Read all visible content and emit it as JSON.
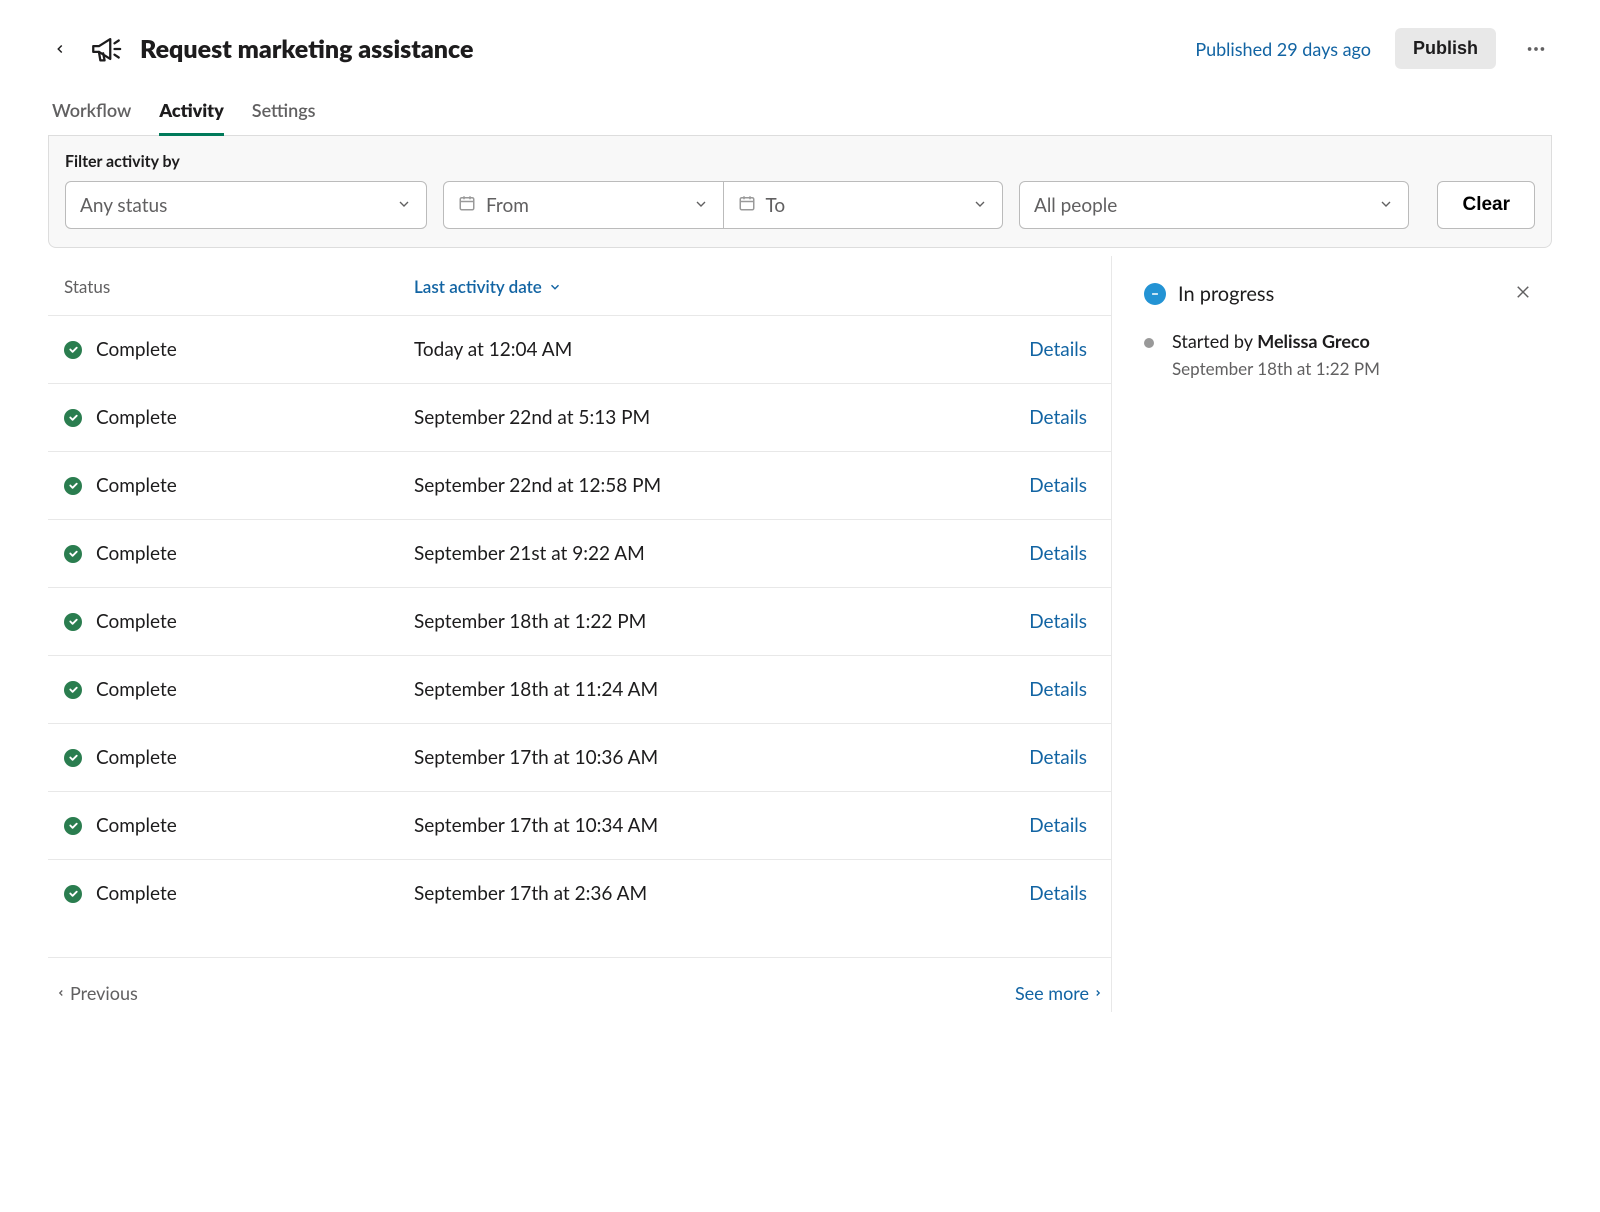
{
  "header": {
    "title": "Request marketing assistance",
    "published_status": "Published 29 days ago",
    "publish_button": "Publish"
  },
  "tabs": [
    {
      "label": "Workflow",
      "active": false
    },
    {
      "label": "Activity",
      "active": true
    },
    {
      "label": "Settings",
      "active": false
    }
  ],
  "filter": {
    "label": "Filter activity by",
    "status_placeholder": "Any status",
    "from_placeholder": "From",
    "to_placeholder": "To",
    "people_placeholder": "All people",
    "clear_button": "Clear"
  },
  "table": {
    "columns": {
      "status": "Status",
      "date": "Last activity date"
    },
    "details_label": "Details",
    "rows": [
      {
        "status": "Complete",
        "date": "Today at 12:04 AM"
      },
      {
        "status": "Complete",
        "date": "September 22nd at 5:13 PM"
      },
      {
        "status": "Complete",
        "date": "September 22nd at 12:58 PM"
      },
      {
        "status": "Complete",
        "date": "September 21st at 9:22 AM"
      },
      {
        "status": "Complete",
        "date": "September 18th at 1:22 PM"
      },
      {
        "status": "Complete",
        "date": "September 18th at 11:24 AM"
      },
      {
        "status": "Complete",
        "date": "September 17th at 10:36 AM"
      },
      {
        "status": "Complete",
        "date": "September 17th at 10:34 AM"
      },
      {
        "status": "Complete",
        "date": "September 17th at 2:36 AM"
      }
    ]
  },
  "pagination": {
    "previous": "Previous",
    "see_more": "See more"
  },
  "panel": {
    "status": "In progress",
    "event_prefix": "Started by ",
    "event_user": "Melissa Greco",
    "event_time": "September 18th at 1:22 PM"
  }
}
